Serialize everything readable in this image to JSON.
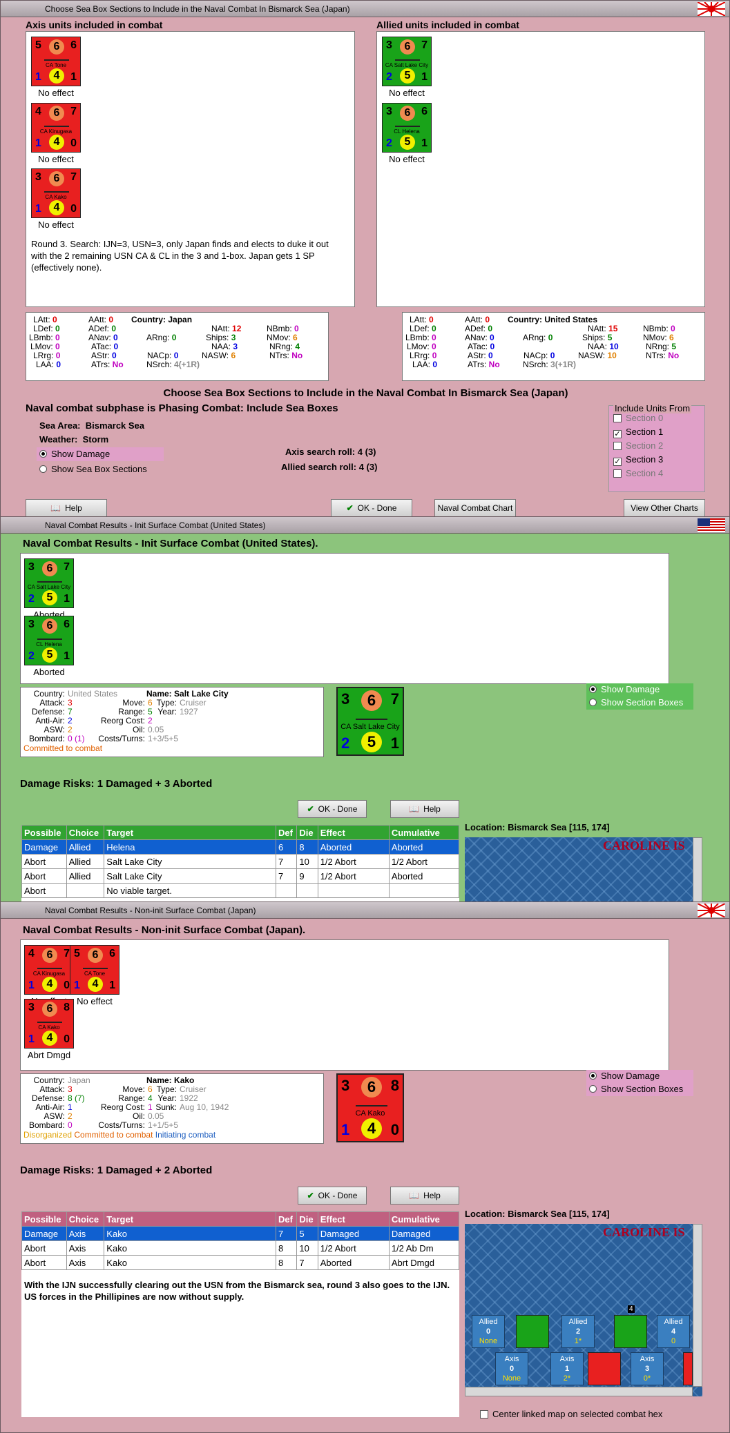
{
  "w1": {
    "title": "Choose Sea Box Sections to Include in the Naval Combat In Bismarck Sea (Japan)",
    "axis_header": "Axis units included in combat",
    "allied_header": "Allied units included in combat",
    "axis_units": [
      {
        "tl": "5",
        "tc": "6",
        "tr": "6",
        "name": "CA Tone",
        "bl": "1",
        "bc": "4",
        "br": "1",
        "status": "No effect"
      },
      {
        "tl": "4",
        "tc": "6",
        "tr": "7",
        "name": "CA Kinugasa",
        "bl": "1",
        "bc": "4",
        "br": "0",
        "status": "No effect"
      },
      {
        "tl": "3",
        "tc": "6",
        "tr": "7",
        "name": "CA Kako",
        "bl": "1",
        "bc": "4",
        "br": "0",
        "status": "No effect"
      }
    ],
    "allied_units": [
      {
        "tl": "3",
        "tc": "6",
        "tr": "7",
        "name": "CA Salt Lake City",
        "bl": "2",
        "bc": "5",
        "br": "1",
        "status": "No effect"
      },
      {
        "tl": "3",
        "tc": "6",
        "tr": "6",
        "name": "CL Helena",
        "bl": "2",
        "bc": "5",
        "br": "1",
        "status": "No effect"
      }
    ],
    "note": "Round 3.  Search:  IJN=3, USN=3, only Japan finds and elects to duke it out with the 2 remaining USN CA & CL in the 3 and 1-box.  Japan gets 1 SP (effectively none).",
    "axis_stats": {
      "country_label": "Country:",
      "country": "Japan",
      "latt": "0",
      "aatt": "0",
      "ldef": "0",
      "adef": "0",
      "lbmb": "0",
      "anav": "0",
      "arng": "0",
      "lmov": "0",
      "atac": "0",
      "lrrg": "0",
      "astr": "0",
      "laa": "0",
      "atrs": "No",
      "natt": "12",
      "nbmb": "0",
      "ships": "3",
      "nmov": "6",
      "naa": "3",
      "nrng": "4",
      "nasw": "6",
      "ntrs": "No",
      "nacp": "0",
      "nsrch": "4(+1R)"
    },
    "allied_stats": {
      "country_label": "Country:",
      "country": "United States",
      "latt": "0",
      "aatt": "0",
      "ldef": "0",
      "adef": "0",
      "lbmb": "0",
      "anav": "0",
      "arng": "0",
      "lmov": "0",
      "atac": "0",
      "lrrg": "0",
      "astr": "0",
      "laa": "0",
      "atrs": "No",
      "natt": "15",
      "nbmb": "0",
      "ships": "5",
      "nmov": "6",
      "naa": "10",
      "nrng": "5",
      "nasw": "10",
      "ntrs": "No",
      "nacp": "0",
      "nsrch": "3(+1R)"
    },
    "heading": "Choose Sea Box Sections to Include in the Naval Combat In Bismarck Sea (Japan)",
    "subphase": "Naval combat subphase is Phasing Combat: Include Sea Boxes",
    "sea_area_label": "Sea Area:",
    "sea_area": "Bismarck Sea",
    "weather_label": "Weather:",
    "weather": "Storm",
    "show_damage": "Show Damage",
    "show_sections": "Show Sea Box Sections",
    "axis_roll_label": "Axis search roll:",
    "axis_roll": "4 (3)",
    "allied_roll_label": "Allied search roll:",
    "allied_roll": "4 (3)",
    "include_title": "Include Units From",
    "sections": [
      {
        "label": "Section 0",
        "checked": false
      },
      {
        "label": "Section 1",
        "checked": true
      },
      {
        "label": "Section 2",
        "checked": false
      },
      {
        "label": "Section 3",
        "checked": true
      },
      {
        "label": "Section 4",
        "checked": false
      }
    ],
    "help": "Help",
    "ok": "OK - Done",
    "chart": "Naval Combat Chart",
    "other": "View Other Charts"
  },
  "w2": {
    "title": "Naval Combat Results - Init Surface Combat (United States)",
    "heading": "Naval Combat Results - Init Surface Combat (United States).",
    "units": [
      {
        "tl": "3",
        "tc": "6",
        "tr": "7",
        "name": "CA Salt Lake City",
        "bl": "2",
        "bc": "5",
        "br": "1",
        "status": "Aborted"
      },
      {
        "tl": "3",
        "tc": "6",
        "tr": "6",
        "name": "CL Helena",
        "bl": "2",
        "bc": "5",
        "br": "1",
        "status": "Aborted"
      }
    ],
    "info": {
      "country_l": "Country:",
      "country": "United States",
      "attack_l": "Attack:",
      "attack": "3",
      "defense_l": "Defense:",
      "defense": "7",
      "aa_l": "Anti-Air:",
      "aa": "2",
      "asw_l": "ASW:",
      "asw": "2",
      "bombard_l": "Bombard:",
      "bombard": "0 (1)",
      "move_l": "Move:",
      "move": "6",
      "range_l": "Range:",
      "range": "5",
      "reorg_l": "Reorg Cost:",
      "reorg": "2",
      "oil_l": "Oil:",
      "oil": "0.05",
      "costs_l": "Costs/Turns:",
      "costs": "1+3/5+5",
      "name_l": "Name:",
      "name": "Salt Lake City",
      "type_l": "Type:",
      "type": "Cruiser",
      "year_l": "Year:",
      "year": "1927",
      "flag1": "Committed to combat"
    },
    "big": {
      "tl": "3",
      "tc": "6",
      "tr": "7",
      "name": "CA Salt Lake City",
      "bl": "2",
      "bc": "5",
      "br": "1"
    },
    "show_damage": "Show Damage",
    "show_sections": "Show Section Boxes",
    "risks": "Damage Risks:  1 Damaged + 3 Aborted",
    "ok": "OK - Done",
    "help": "Help",
    "cols": [
      "Possible",
      "Choice",
      "Target",
      "Def",
      "Die",
      "Effect",
      "Cumulative"
    ],
    "rows": [
      [
        "Damage",
        "Allied",
        "Helena",
        "6",
        "8",
        "Aborted",
        "Aborted"
      ],
      [
        "Abort",
        "Allied",
        "Salt Lake City",
        "7",
        "10",
        "1/2 Abort",
        "1/2 Abort"
      ],
      [
        "Abort",
        "Allied",
        "Salt Lake City",
        "7",
        "9",
        "1/2 Abort",
        "Aborted"
      ],
      [
        "Abort",
        "",
        "No viable target.",
        "",
        "",
        "",
        ""
      ]
    ],
    "location": "Location:  Bismarck Sea [115, 174]",
    "mapname": "CAROLINE IS"
  },
  "w3": {
    "title": "Naval Combat Results - Non-init Surface Combat (Japan)",
    "heading": "Naval Combat Results - Non-init Surface Combat (Japan).",
    "units": [
      {
        "tl": "4",
        "tc": "6",
        "tr": "7",
        "name": "CA Kinugasa",
        "bl": "1",
        "bc": "4",
        "br": "0",
        "status": "No effect"
      },
      {
        "tl": "5",
        "tc": "6",
        "tr": "6",
        "name": "CA Tone",
        "bl": "1",
        "bc": "4",
        "br": "1",
        "status": "No effect"
      },
      {
        "tl": "3",
        "tc": "6",
        "tr": "8",
        "name": "CA Kako",
        "bl": "1",
        "bc": "4",
        "br": "0",
        "status": "Abrt Dmgd"
      }
    ],
    "info": {
      "country_l": "Country:",
      "country": "Japan",
      "attack_l": "Attack:",
      "attack": "3",
      "defense_l": "Defense:",
      "defense": "8 (7)",
      "aa_l": "Anti-Air:",
      "aa": "1",
      "asw_l": "ASW:",
      "asw": "2",
      "bombard_l": "Bombard:",
      "bombard": "0",
      "move_l": "Move:",
      "move": "6",
      "range_l": "Range:",
      "range": "4",
      "reorg_l": "Reorg Cost:",
      "reorg": "1",
      "oil_l": "Oil:",
      "oil": "0.05",
      "costs_l": "Costs/Turns:",
      "costs": "1+1/5+5",
      "name_l": "Name:",
      "name": "Kako",
      "type_l": "Type:",
      "type": "Cruiser",
      "year_l": "Year:",
      "year": "1922",
      "sunk_l": "Sunk:",
      "sunk": "Aug 10, 1942",
      "flag1": "Disorganized",
      "flag2": "Committed to combat",
      "flag3": "Initiating combat"
    },
    "big": {
      "tl": "3",
      "tc": "6",
      "tr": "8",
      "name": "CA Kako",
      "bl": "1",
      "bc": "4",
      "br": "0"
    },
    "show_damage": "Show Damage",
    "show_sections": "Show Section Boxes",
    "risks": "Damage Risks:  1 Damaged + 2 Aborted",
    "ok": "OK - Done",
    "help": "Help",
    "cols": [
      "Possible",
      "Choice",
      "Target",
      "Def",
      "Die",
      "Effect",
      "Cumulative"
    ],
    "rows": [
      [
        "Damage",
        "Axis",
        "Kako",
        "7",
        "5",
        "Damaged",
        "Damaged"
      ],
      [
        "Abort",
        "Axis",
        "Kako",
        "8",
        "10",
        "1/2 Abort",
        "1/2 Ab Dm"
      ],
      [
        "Abort",
        "Axis",
        "Kako",
        "8",
        "7",
        "Aborted",
        "Abrt Dmgd"
      ]
    ],
    "note": "With the IJN successfully clearing out the USN from the Bismarck sea, round 3 also goes to the IJN.  US forces in the Phillipines are now without supply.",
    "location": "Location:  Bismarck Sea [115, 174]",
    "mapname": "CAROLINE IS",
    "boxes": [
      {
        "side": "Allied",
        "n": "0",
        "v": "None"
      },
      {
        "side": "Allied",
        "n": "2",
        "v": "1*"
      },
      {
        "side": "Allied",
        "n": "4",
        "v": "0"
      },
      {
        "side": "Axis",
        "n": "0",
        "v": "None"
      },
      {
        "side": "Axis",
        "n": "1",
        "v": "2*"
      },
      {
        "side": "Axis",
        "n": "3",
        "v": "0*"
      }
    ],
    "stack": "4",
    "center_label": "Center linked map on selected combat hex"
  }
}
